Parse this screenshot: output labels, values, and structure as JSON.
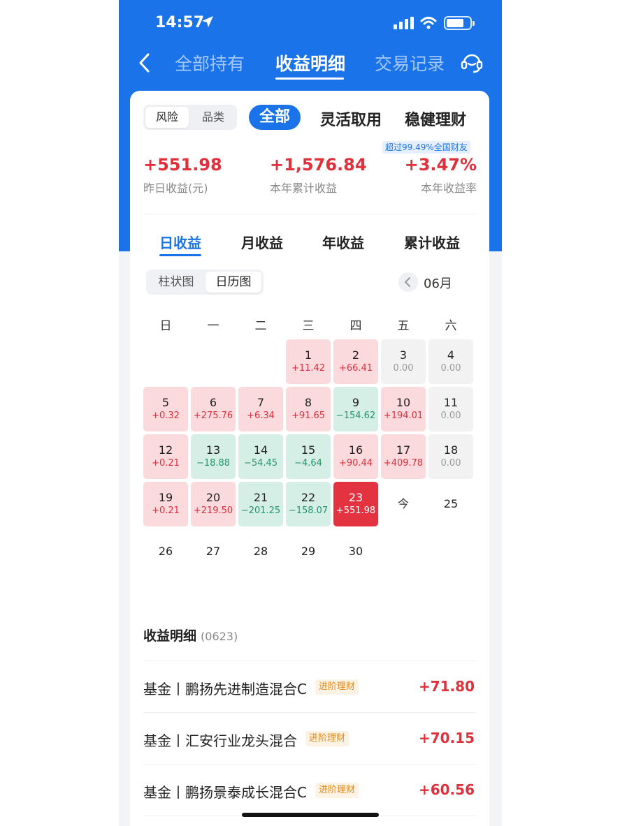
{
  "status": {
    "time": "14:57"
  },
  "nav": {
    "tabs": [
      "全部持有",
      "收益明细",
      "交易记录"
    ],
    "active": "收益明细"
  },
  "filters": {
    "seg": [
      "风险",
      "品类"
    ],
    "all": "全部",
    "tabs": [
      "灵活取用",
      "稳健理财"
    ]
  },
  "rank_badge": "超过99.49%全国财友",
  "stats": [
    {
      "value": "+551.98",
      "label": "昨日收益(元)"
    },
    {
      "value": "+1,576.84",
      "label": "本年累计收益"
    },
    {
      "value": "+3.47%",
      "label": "本年收益率"
    }
  ],
  "period_tabs": [
    "日收益",
    "月收益",
    "年收益",
    "累计收益"
  ],
  "view_seg": [
    "柱状图",
    "日历图"
  ],
  "month": "06月",
  "weekdays": [
    "日",
    "一",
    "二",
    "三",
    "四",
    "五",
    "六"
  ],
  "calendar": [
    {
      "day": "1",
      "value": "+11.42",
      "type": "pos"
    },
    {
      "day": "2",
      "value": "+66.41",
      "type": "pos"
    },
    {
      "day": "3",
      "value": "0.00",
      "type": "zero"
    },
    {
      "day": "4",
      "value": "0.00",
      "type": "zero"
    },
    {
      "day": "5",
      "value": "+0.32",
      "type": "pos"
    },
    {
      "day": "6",
      "value": "+275.76",
      "type": "pos"
    },
    {
      "day": "7",
      "value": "+6.34",
      "type": "pos"
    },
    {
      "day": "8",
      "value": "+91.65",
      "type": "pos"
    },
    {
      "day": "9",
      "value": "−154.62",
      "type": "neg"
    },
    {
      "day": "10",
      "value": "+194.01",
      "type": "pos"
    },
    {
      "day": "11",
      "value": "0.00",
      "type": "zero"
    },
    {
      "day": "12",
      "value": "+0.21",
      "type": "pos"
    },
    {
      "day": "13",
      "value": "−18.88",
      "type": "neg"
    },
    {
      "day": "14",
      "value": "−54.45",
      "type": "neg"
    },
    {
      "day": "15",
      "value": "−4.64",
      "type": "neg"
    },
    {
      "day": "16",
      "value": "+90.44",
      "type": "pos"
    },
    {
      "day": "17",
      "value": "+409.78",
      "type": "pos"
    },
    {
      "day": "18",
      "value": "0.00",
      "type": "zero"
    },
    {
      "day": "19",
      "value": "+0.21",
      "type": "pos"
    },
    {
      "day": "20",
      "value": "+219.50",
      "type": "pos"
    },
    {
      "day": "21",
      "value": "−201.25",
      "type": "neg"
    },
    {
      "day": "22",
      "value": "−158.07",
      "type": "neg"
    },
    {
      "day": "23",
      "value": "+551.98",
      "type": "sel"
    },
    {
      "day": "今",
      "value": "",
      "type": "today"
    },
    {
      "day": "25",
      "value": "",
      "type": "plain"
    },
    {
      "day": "26",
      "value": "",
      "type": "plain"
    },
    {
      "day": "27",
      "value": "",
      "type": "plain"
    },
    {
      "day": "28",
      "value": "",
      "type": "plain"
    },
    {
      "day": "29",
      "value": "",
      "type": "plain"
    },
    {
      "day": "30",
      "value": "",
      "type": "plain"
    }
  ],
  "detail": {
    "title": "收益明细",
    "date": "(0623)",
    "rows": [
      {
        "name": "基金丨鹏扬先进制造混合C",
        "tag": "进阶理财",
        "amount": "+71.80"
      },
      {
        "name": "基金丨汇安行业龙头混合",
        "tag": "进阶理财",
        "amount": "+70.15"
      },
      {
        "name": "基金丨鹏扬景泰成长混合C",
        "tag": "进阶理财",
        "amount": "+60.56"
      }
    ]
  }
}
